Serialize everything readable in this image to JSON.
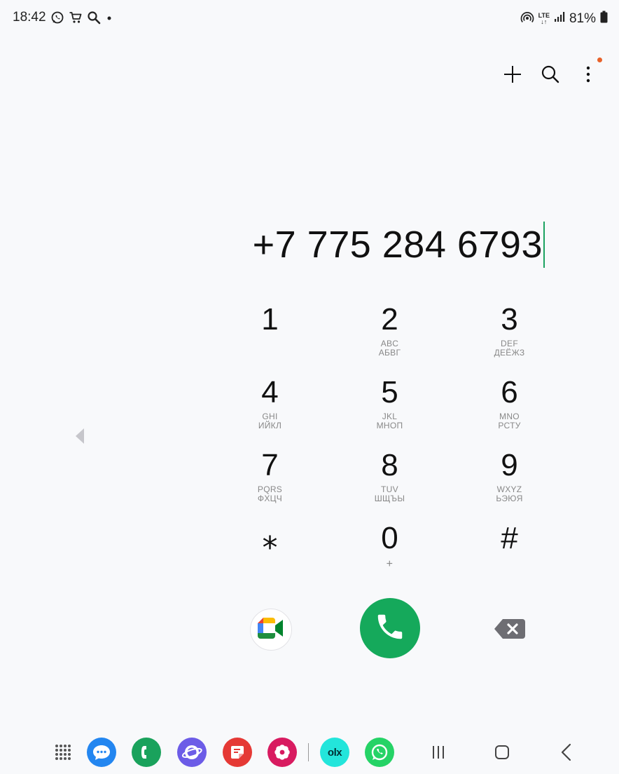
{
  "status_bar": {
    "time": "18:42",
    "notification_icons": [
      "whatsapp-icon",
      "cart-icon",
      "search-icon",
      "dot-icon"
    ],
    "network": "LTE",
    "battery": "81%"
  },
  "top_actions": [
    "add-contact-icon",
    "search-icon",
    "more-options-icon"
  ],
  "dialer": {
    "number": "+7 775 284 6793",
    "keys": [
      [
        {
          "digit": "1",
          "l1": "",
          "l2": ""
        },
        {
          "digit": "2",
          "l1": "ABC",
          "l2": "АБВГ"
        },
        {
          "digit": "3",
          "l1": "DEF",
          "l2": "ДЕЁЖЗ"
        }
      ],
      [
        {
          "digit": "4",
          "l1": "GHI",
          "l2": "ИЙКЛ"
        },
        {
          "digit": "5",
          "l1": "JKL",
          "l2": "МНОП"
        },
        {
          "digit": "6",
          "l1": "MNO",
          "l2": "РСТУ"
        }
      ],
      [
        {
          "digit": "7",
          "l1": "PQRS",
          "l2": "ФХЦЧ"
        },
        {
          "digit": "8",
          "l1": "TUV",
          "l2": "ШЩЪЫ"
        },
        {
          "digit": "9",
          "l1": "WXYZ",
          "l2": "ЬЭЮЯ"
        }
      ],
      [
        {
          "digit": "⁎",
          "l1": "",
          "l2": ""
        },
        {
          "digit": "0",
          "l1": "+",
          "l2": ""
        },
        {
          "digit": "#",
          "l1": "",
          "l2": ""
        }
      ]
    ]
  },
  "colors": {
    "call_green": "#15a95b",
    "cursor_green": "#1aa260",
    "notification_dot": "#e8622a"
  },
  "dock": {
    "apps": [
      "app-drawer-icon",
      "messages-icon",
      "phone-app-icon",
      "internet-icon",
      "notes-icon",
      "gallery-icon",
      "olx-icon",
      "whatsapp-icon"
    ],
    "olx_label": "olx",
    "nav": [
      "recents-icon",
      "home-icon",
      "back-icon"
    ]
  }
}
